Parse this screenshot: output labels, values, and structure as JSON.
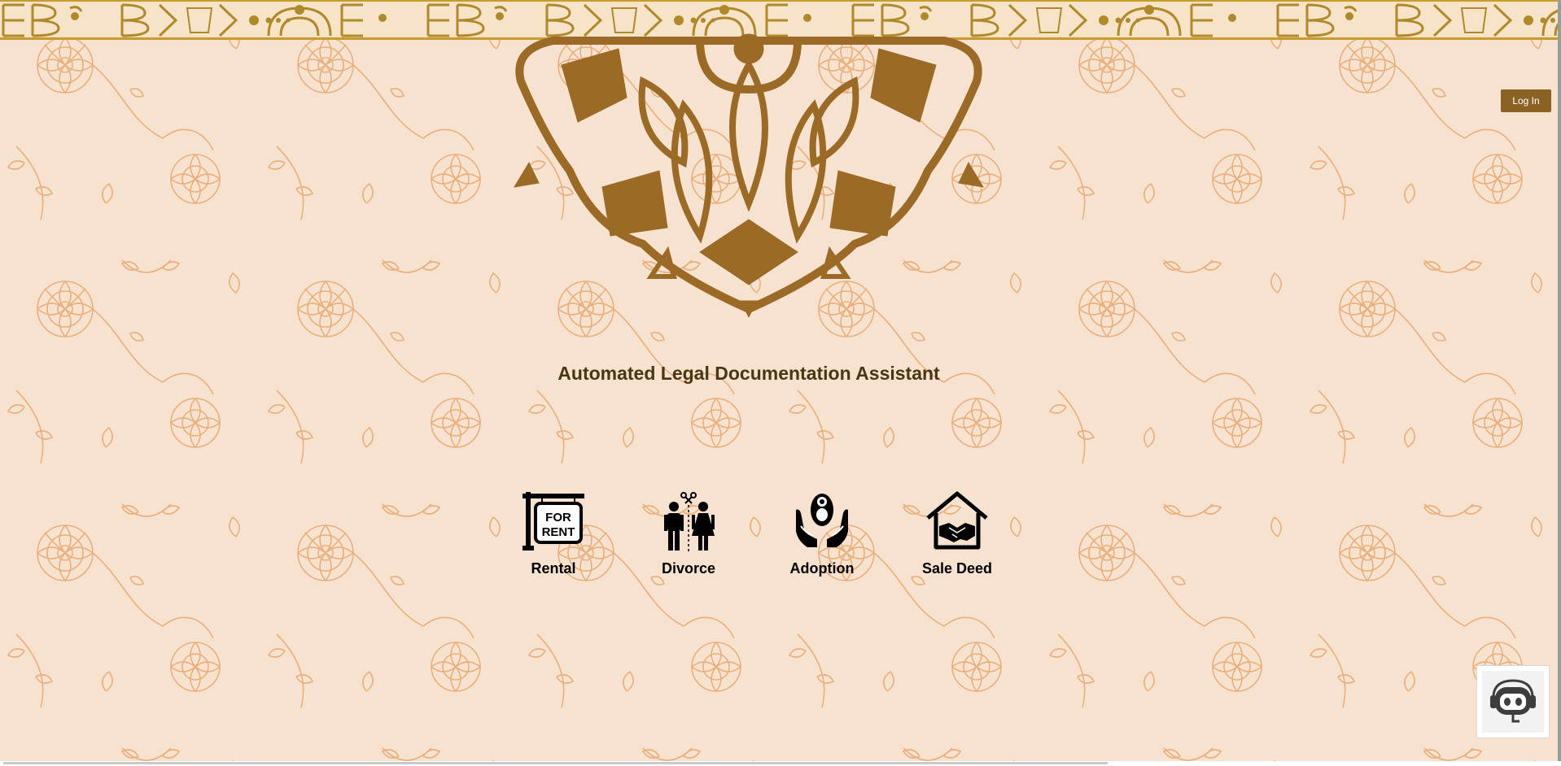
{
  "header": {
    "login_label": "Log In"
  },
  "main": {
    "title": "Automated Legal Documentation Assistant",
    "services": [
      {
        "label": "Rental",
        "icon": "for-rent-sign-icon",
        "sign_line1": "FOR",
        "sign_line2": "RENT"
      },
      {
        "label": "Divorce",
        "icon": "divorce-couple-icon"
      },
      {
        "label": "Adoption",
        "icon": "baby-in-hands-icon"
      },
      {
        "label": "Sale Deed",
        "icon": "house-handshake-icon"
      }
    ]
  },
  "chat": {
    "icon": "chatbot-icon"
  },
  "colors": {
    "background": "#f7e2cf",
    "pattern": "#e7a56a",
    "mandala": "#9b6a27",
    "border": "#c99a2c",
    "accent_button": "#8a6224",
    "title": "#4a3514"
  }
}
